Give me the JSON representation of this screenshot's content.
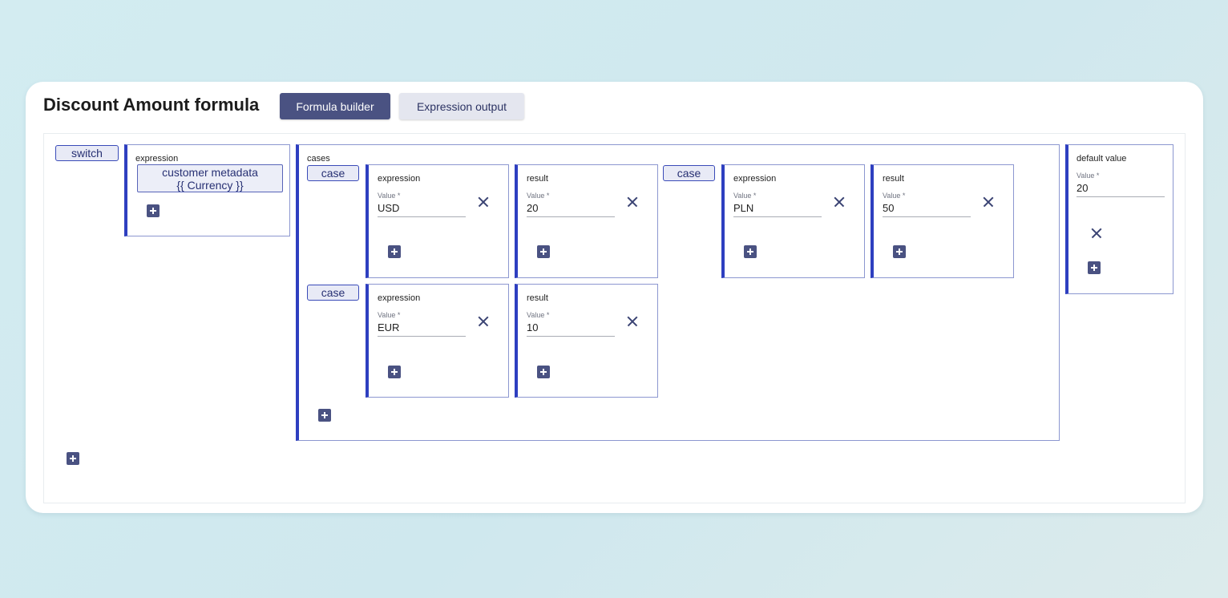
{
  "header": {
    "title": "Discount Amount formula",
    "tabs": [
      {
        "label": "Formula builder",
        "active": true
      },
      {
        "label": "Expression output",
        "active": false
      }
    ]
  },
  "switch_block": {
    "tag": "switch",
    "expression": {
      "label": "expression",
      "value_line1": "customer metadata",
      "value_line2": "{{ Currency }}"
    },
    "cases": {
      "label": "cases",
      "items": [
        {
          "tag": "case",
          "expression": {
            "label": "expression",
            "field_label": "Value *",
            "value": "USD"
          },
          "result": {
            "label": "result",
            "field_label": "Value *",
            "value": "20"
          }
        },
        {
          "tag": "case",
          "expression": {
            "label": "expression",
            "field_label": "Value *",
            "value": "PLN"
          },
          "result": {
            "label": "result",
            "field_label": "Value *",
            "value": "50"
          }
        },
        {
          "tag": "case",
          "expression": {
            "label": "expression",
            "field_label": "Value *",
            "value": "EUR"
          },
          "result": {
            "label": "result",
            "field_label": "Value *",
            "value": "10"
          }
        }
      ]
    },
    "default_value": {
      "label": "default value",
      "field_label": "Value *",
      "value": "20"
    }
  },
  "icons": {
    "add": "plus-square-icon",
    "remove": "close-icon"
  },
  "colors": {
    "accent": "#4a5282",
    "block_border": "#2e3fc0",
    "tag_background": "#e8eaf6",
    "page_background": "#d3ecf1"
  }
}
